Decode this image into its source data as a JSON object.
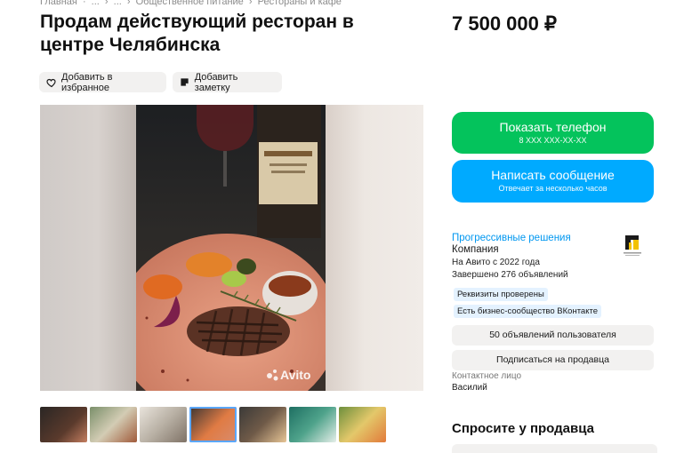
{
  "breadcrumbs": [
    "Главная",
    "·",
    "...",
    "›",
    "...",
    "›",
    "Общественное питание",
    "›",
    "Рестораны и кафе"
  ],
  "listing": {
    "title": "Продам действующий ресторан в центре Челябинска",
    "price": "7 500 000 ₽"
  },
  "actions": {
    "favorite_label": "Добавить в избранное",
    "note_label": "Добавить заметку"
  },
  "gallery": {
    "watermark": "Avito",
    "thumbnail_count": 7,
    "active_thumbnail": 4
  },
  "contact": {
    "phone_button": "Показать телефон",
    "phone_masked": "8 XXX XXX-XX-XX",
    "message_button": "Написать сообщение",
    "message_sub": "Отвечает за несколько часов"
  },
  "seller": {
    "name": "Прогрессивные решения",
    "type": "Компания",
    "since": "На Авито с 2022 года",
    "completed": "Завершено 276 объявлений",
    "badge_verified": "Реквизиты проверены",
    "badge_community": "Есть бизнес-сообщество ВКонтакте",
    "ads_button": "50 объявлений пользователя",
    "subscribe_button": "Подписаться на продавца",
    "contact_label": "Контактное лицо",
    "contact_name": "Василий"
  },
  "ask": {
    "title": "Спросите у продавца"
  },
  "colors": {
    "green": "#04c35c",
    "blue": "#00aaff",
    "link": "#0097f0",
    "chip_bg": "#f2f1f0",
    "badge_bg": "#e4f2ff"
  },
  "icons": {
    "favorite": "heart-icon",
    "note": "note-icon",
    "seller_logo": "company-logo"
  }
}
